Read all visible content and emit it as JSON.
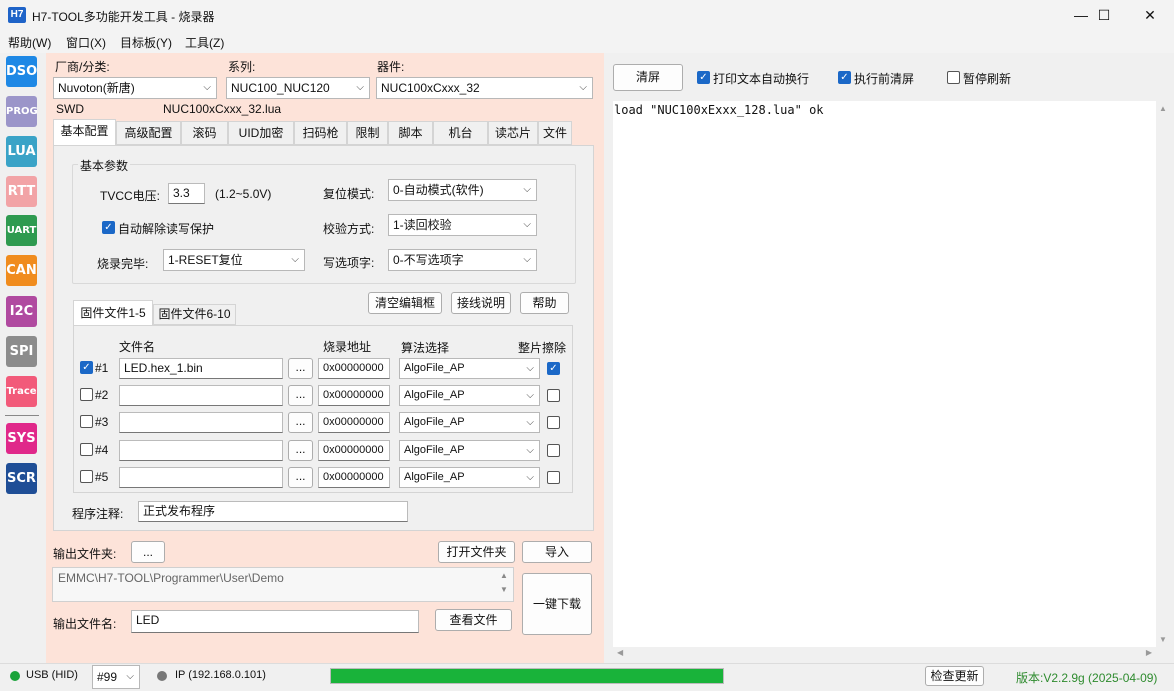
{
  "window": {
    "icon_text": "H7",
    "title": "H7-TOOL多功能开发工具 - 烧录器",
    "minimize": "—",
    "maximize": "☐",
    "close": "✕"
  },
  "menu": [
    "帮助(W)",
    "窗口(X)",
    "目标板(Y)",
    "工具(Z)"
  ],
  "sidebar": [
    {
      "label": "DSO",
      "color": "#1e88e5"
    },
    {
      "label": "PROG",
      "color": "#9b95c9"
    },
    {
      "label": "LUA",
      "color": "#3aa3c7"
    },
    {
      "label": "RTT",
      "color": "#f2a3a6"
    },
    {
      "label": "UART",
      "color": "#2e9a50"
    },
    {
      "label": "CAN",
      "color": "#f08c1e"
    },
    {
      "label": "I2C",
      "color": "#b04aa0"
    },
    {
      "label": "SPI",
      "color": "#8c8c8c"
    },
    {
      "label": "Trace",
      "color": "#f25a7a"
    },
    {
      "label": "SYS",
      "color": "#e0288a"
    },
    {
      "label": "SCR",
      "color": "#1f4e96"
    }
  ],
  "device": {
    "vendor_label": "厂商/分类:",
    "vendor_value": "Nuvoton(新唐)",
    "series_label": "系列:",
    "series_value": "NUC100_NUC120",
    "chip_label": "器件:",
    "chip_value": "NUC100xCxxx_32",
    "interface": "SWD",
    "lua_file": "NUC100xCxxx_32.lua"
  },
  "tabs": [
    "基本配置",
    "高级配置",
    "滚码",
    "UID加密",
    "扫码枪",
    "限制",
    "脚本",
    "机台",
    "读芯片",
    "文件"
  ],
  "basic": {
    "group_title": "基本参数",
    "tvcc_label": "TVCC电压:",
    "tvcc_value": "3.3",
    "tvcc_range": "(1.2~5.0V)",
    "reset_label": "复位模式:",
    "reset_value": "0-自动模式(软件)",
    "auto_unlock_label": "自动解除读写保护",
    "verify_label": "校验方式:",
    "verify_value": "1-读回校验",
    "done_label": "烧录完毕:",
    "done_value": "1-RESET复位",
    "option_label": "写选项字:",
    "option_value": "0-不写选项字"
  },
  "buttons": {
    "clear_editor": "清空编辑框",
    "wiring": "接线说明",
    "help": "帮助"
  },
  "fw_tabs": [
    "固件文件1-5",
    "固件文件6-10"
  ],
  "fw_headers": {
    "file": "文件名",
    "addr": "烧录地址",
    "algo": "算法选择",
    "erase": "整片擦除"
  },
  "fw_rows": [
    {
      "checked": true,
      "id": "#1",
      "file": "LED.hex_1.bin",
      "browse": "...",
      "addr": "0x00000000",
      "algo": "AlgoFile_AP",
      "erase": true
    },
    {
      "checked": false,
      "id": "#2",
      "file": "",
      "browse": "...",
      "addr": "0x00000000",
      "algo": "AlgoFile_AP",
      "erase": false
    },
    {
      "checked": false,
      "id": "#3",
      "file": "",
      "browse": "...",
      "addr": "0x00000000",
      "algo": "AlgoFile_AP",
      "erase": false
    },
    {
      "checked": false,
      "id": "#4",
      "file": "",
      "browse": "...",
      "addr": "0x00000000",
      "algo": "AlgoFile_AP",
      "erase": false
    },
    {
      "checked": false,
      "id": "#5",
      "file": "",
      "browse": "...",
      "addr": "0x00000000",
      "algo": "AlgoFile_AP",
      "erase": false
    }
  ],
  "comment": {
    "label": "程序注释:",
    "value": "正式发布程序"
  },
  "output": {
    "folder_label": "输出文件夹:",
    "folder_browse": "...",
    "open_folder": "打开文件夹",
    "import": "导入",
    "path": "EMMC\\H7-TOOL\\Programmer\\User\\Demo",
    "name_label": "输出文件名:",
    "name_value": "LED",
    "view_file": "查看文件",
    "one_click": "一键下载"
  },
  "right": {
    "clear_button": "清屏",
    "wrap_label": "打印文本自动换行",
    "clear_before_label": "执行前清屏",
    "pause_label": "暂停刷新",
    "log": "load \"NUC100xExxx_128.lua\" ok"
  },
  "status": {
    "usb": "USB (HID)",
    "usb_color": "#1aa33a",
    "port": "#99",
    "ip": "IP (192.168.0.101)",
    "ip_color": "#777777",
    "progress": 1.0,
    "progress_color": "#19b33a",
    "check_update": "检查更新",
    "version": "版本:V2.2.9g (2025-04-09)"
  }
}
